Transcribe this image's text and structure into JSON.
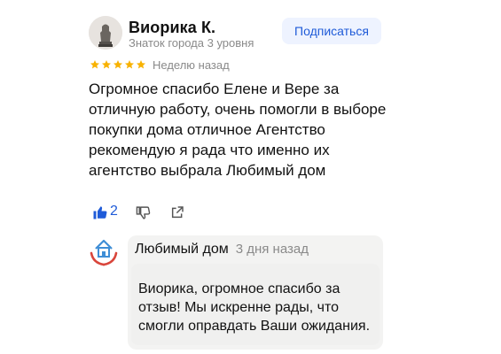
{
  "review": {
    "author": {
      "name": "Виорика К.",
      "level": "Знаток города 3 уровня",
      "avatar_icon": "statue-avatar-icon"
    },
    "subscribe_label": "Подписаться",
    "rating": 5,
    "rating_max": 5,
    "date": "Неделю назад",
    "text": "Огромное спасибо Елене и Вере за отличную работу, очень помогли в выборе покупки дома отличное Агентство рекомендую я рада что именно их агентство выбрала Любимый дом",
    "actions": {
      "like_count": "2",
      "like_icon": "thumbs-up-icon",
      "dislike_icon": "thumbs-down-icon",
      "share_icon": "share-icon"
    }
  },
  "reply": {
    "author": "Любимый дом",
    "date": "3 дня назад",
    "logo_icon": "house-in-hands-logo-icon",
    "text": "Виорика, огромное спасибо за отзыв! Мы искренне рады, что смогли оправдать Ваши ожидания."
  },
  "colors": {
    "accent": "#1f5bd8",
    "star": "#f8b200",
    "muted": "#8a8a8a",
    "bubble": "#f3f3f2",
    "logo_house": "#3f8ed6",
    "logo_hands": "#d9453b"
  }
}
